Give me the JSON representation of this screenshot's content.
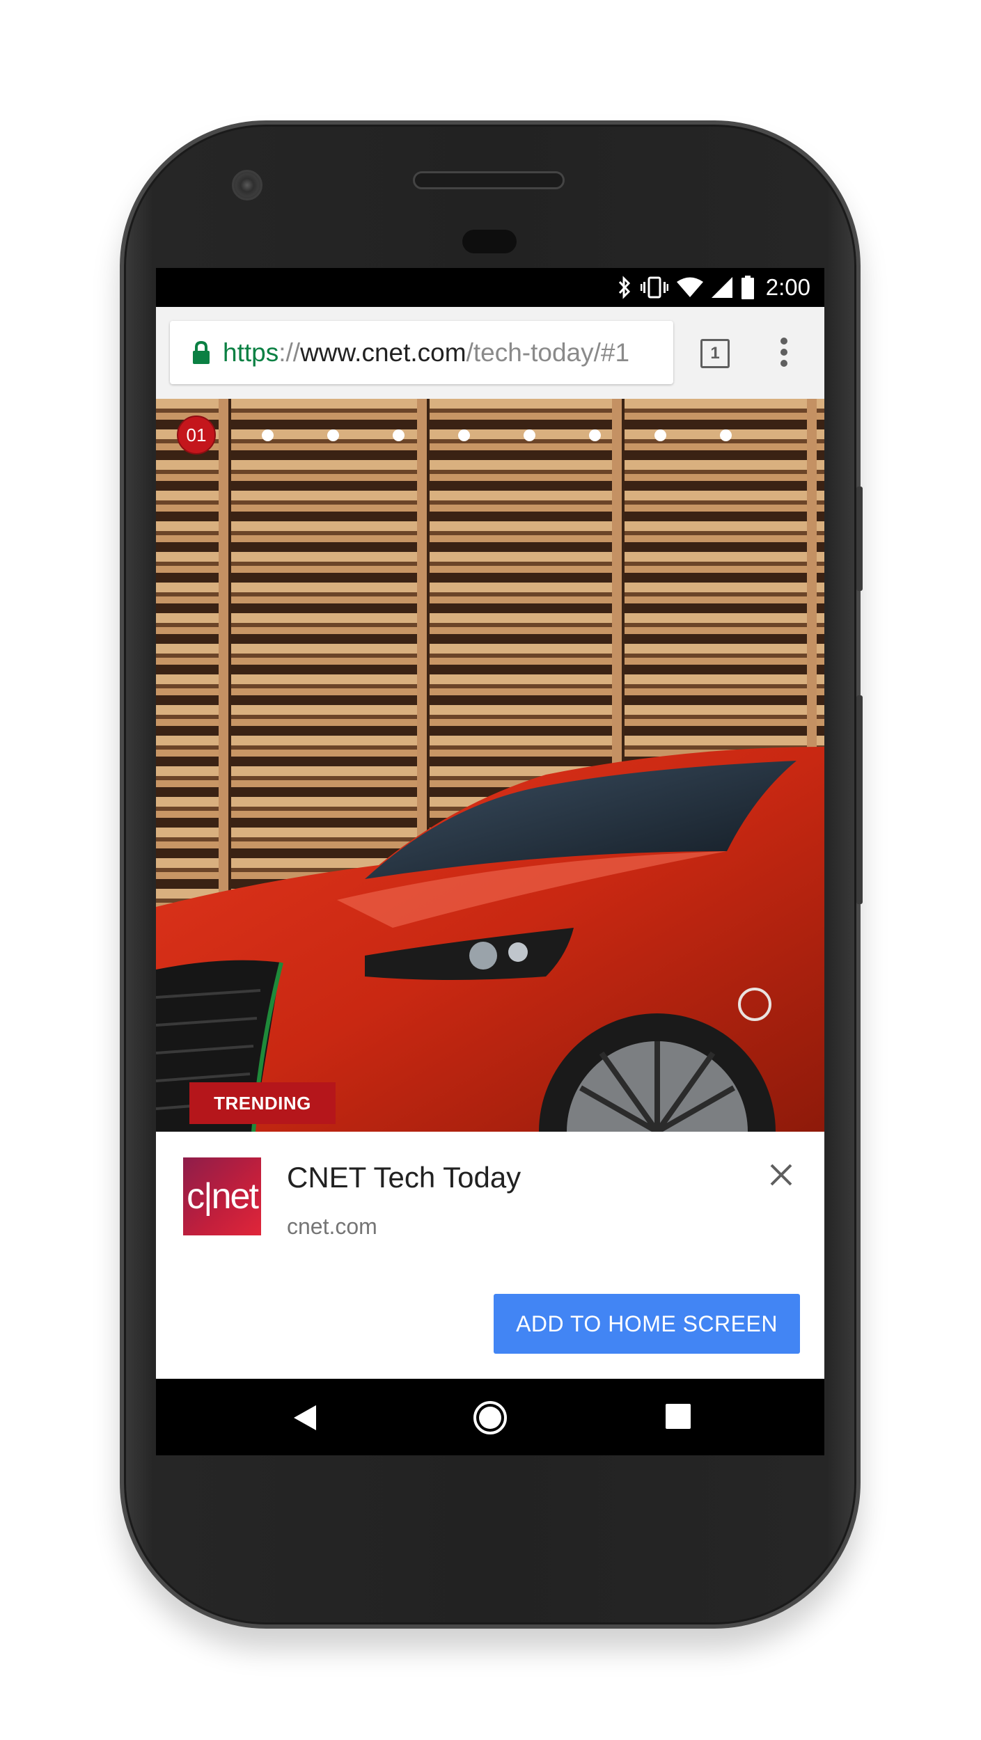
{
  "status_bar": {
    "time": "2:00",
    "icons": [
      "bluetooth-icon",
      "vibrate-icon",
      "wifi-icon",
      "signal-icon",
      "battery-icon"
    ]
  },
  "browser": {
    "url": {
      "scheme": "https",
      "separator": "://",
      "host": "www.cnet.com",
      "path": "/tech-today/#1"
    },
    "tab_count": "1",
    "icons": [
      "lock-icon",
      "tab-switcher-icon",
      "overflow-menu-icon"
    ]
  },
  "hero": {
    "slide_number": "01",
    "total_dots": 9,
    "badge": "TRENDING"
  },
  "install_banner": {
    "app_logo_text": "c|net",
    "app_title": "CNET Tech Today",
    "app_url": "cnet.com",
    "add_button": "ADD TO HOME SCREEN"
  },
  "nav_bar": {
    "icons": [
      "back-icon",
      "home-icon",
      "recents-icon"
    ]
  },
  "colors": {
    "secure_green": "#0b8043",
    "cnet_red": "#c4161c",
    "button_blue": "#4285f4"
  }
}
